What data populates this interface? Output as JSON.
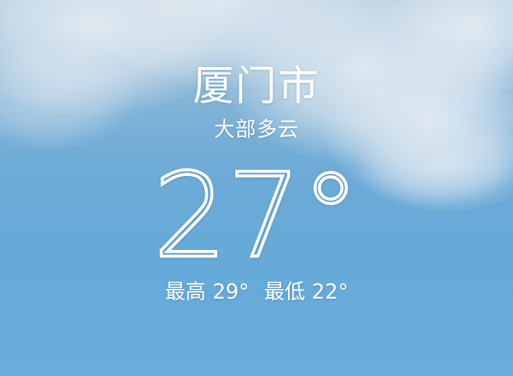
{
  "location": {
    "city": "厦门市",
    "condition": "大部多云"
  },
  "current": {
    "temperature": "27°"
  },
  "range": {
    "high": "最高 29°",
    "low": "最低 22°"
  },
  "colors": {
    "sky_top": "#a9c9df",
    "sky_bottom": "#5ea7da",
    "text": "#ffffff"
  }
}
